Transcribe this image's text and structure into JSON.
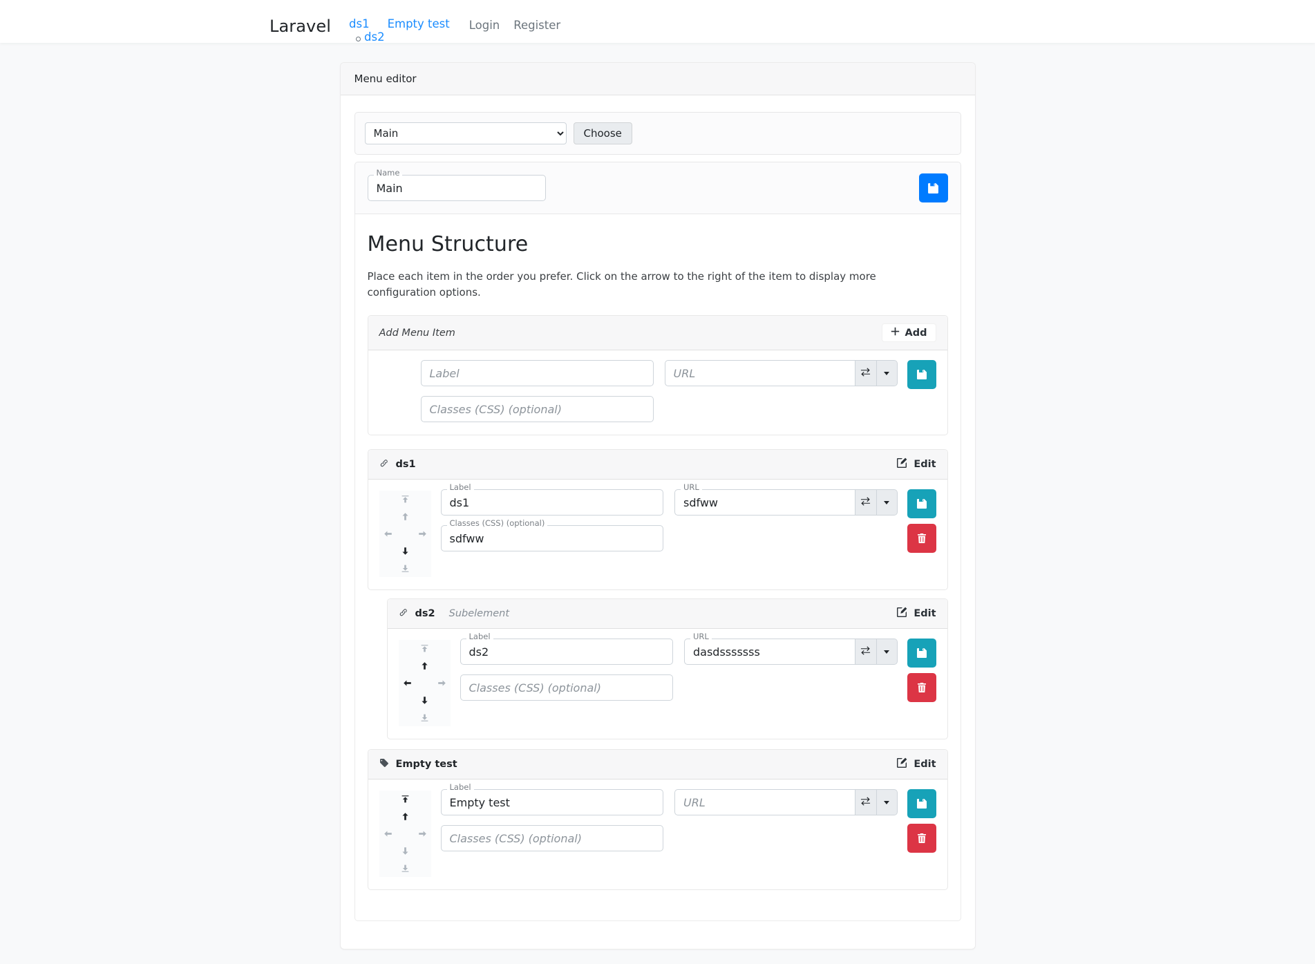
{
  "navbar": {
    "brand": "Laravel",
    "items": [
      {
        "label": "ds1",
        "children": [
          {
            "label": "ds2"
          }
        ]
      },
      {
        "label": "Empty test",
        "children": []
      }
    ],
    "auth": [
      {
        "label": "Login"
      },
      {
        "label": "Register"
      }
    ]
  },
  "card": {
    "header": "Menu editor"
  },
  "chooser": {
    "selected": "Main",
    "options": [
      "Main"
    ],
    "choose_label": "Choose"
  },
  "name_panel": {
    "label": "Name",
    "value": "Main",
    "save_icon": "save-icon"
  },
  "structure": {
    "title": "Menu Structure",
    "description": "Place each item in the order you prefer. Click on the arrow to the right of the item to display more configuration options."
  },
  "add_menu_item": {
    "title": "Add Menu Item",
    "add_label": "Add",
    "label_placeholder": "Label",
    "label_value": "",
    "url_placeholder": "URL",
    "url_value": "",
    "classes_placeholder": "Classes (CSS) (optional)",
    "classes_value": ""
  },
  "field_labels": {
    "label": "Label",
    "url": "URL",
    "classes": "Classes (CSS) (optional)"
  },
  "edit_label": "Edit",
  "items": [
    {
      "icon": "link-icon",
      "title": "ds1",
      "subtitle": "",
      "label_value": "ds1",
      "label_placeholder": "Label",
      "url_value": "sdfww",
      "url_placeholder": "URL",
      "classes_value": "sdfww",
      "classes_placeholder": "Classes (CSS) (optional)",
      "arrows": {
        "top": "dim",
        "up": "dim",
        "left": "dim",
        "right": "dim",
        "down": "on",
        "bottom": "dim"
      }
    },
    {
      "icon": "link-icon",
      "title": "ds2",
      "subtitle": "Subelement",
      "label_value": "ds2",
      "label_placeholder": "Label",
      "url_value": "dasdsssssss",
      "url_placeholder": "URL",
      "classes_value": "",
      "classes_placeholder": "Classes (CSS) (optional)",
      "arrows": {
        "top": "dim",
        "up": "on",
        "left": "on",
        "right": "dim",
        "down": "on",
        "bottom": "dim"
      }
    },
    {
      "icon": "tag-icon",
      "title": "Empty test",
      "subtitle": "",
      "label_value": "Empty test",
      "label_placeholder": "Label",
      "url_value": "",
      "url_placeholder": "URL",
      "classes_value": "",
      "classes_placeholder": "Classes (CSS) (optional)",
      "arrows": {
        "top": "on",
        "up": "on",
        "left": "dim",
        "right": "dim",
        "down": "dim",
        "bottom": "dim"
      }
    }
  ],
  "colors": {
    "primary": "#007bff",
    "teal": "#17a2b8",
    "danger": "#dc3545",
    "link": "#1a8cff",
    "muted": "#6c757d"
  }
}
